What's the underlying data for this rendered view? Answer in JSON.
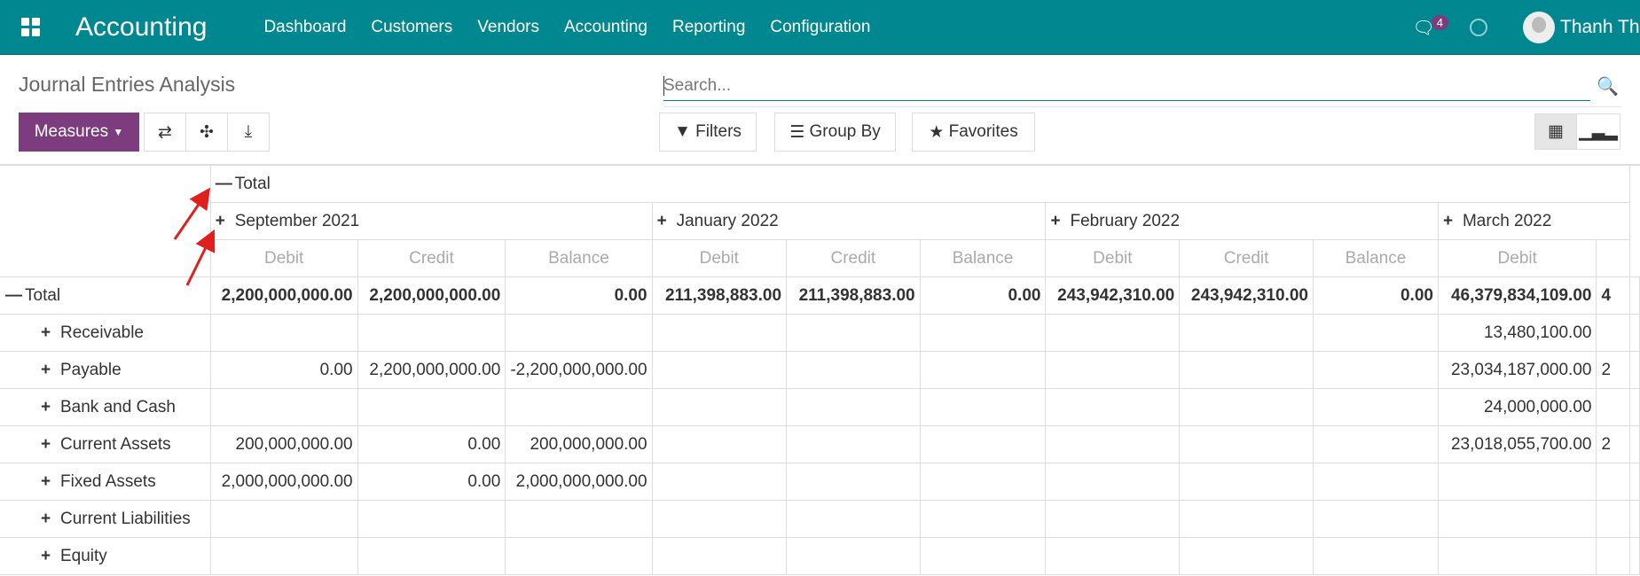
{
  "navbar": {
    "app": "Accounting",
    "menu": [
      "Dashboard",
      "Customers",
      "Vendors",
      "Accounting",
      "Reporting",
      "Configuration"
    ],
    "messages_count": "4",
    "user": "Thanh Thư"
  },
  "page": {
    "title": "Journal Entries Analysis",
    "search_placeholder": "Search...",
    "measures": "Measures",
    "filters": "Filters",
    "group_by": "Group By",
    "favorites": "Favorites"
  },
  "pivot": {
    "col_total": "Total",
    "months": [
      "September 2021",
      "January 2022",
      "February 2022",
      "March 2022"
    ],
    "measures": [
      "Debit",
      "Credit",
      "Balance"
    ],
    "rows": [
      {
        "label": "Total",
        "cells": [
          "2,200,000,000.00",
          "2,200,000,000.00",
          "0.00",
          "211,398,883.00",
          "211,398,883.00",
          "0.00",
          "243,942,310.00",
          "243,942,310.00",
          "0.00",
          "46,379,834,109.00",
          "4"
        ]
      },
      {
        "label": "Receivable",
        "cells": [
          "",
          "",
          "",
          "",
          "",
          "",
          "",
          "",
          "",
          "13,480,100.00",
          ""
        ]
      },
      {
        "label": "Payable",
        "cells": [
          "0.00",
          "2,200,000,000.00",
          "-2,200,000,000.00",
          "",
          "",
          "",
          "",
          "",
          "",
          "23,034,187,000.00",
          "2"
        ]
      },
      {
        "label": "Bank and Cash",
        "cells": [
          "",
          "",
          "",
          "",
          "",
          "",
          "",
          "",
          "",
          "24,000,000.00",
          ""
        ]
      },
      {
        "label": "Current Assets",
        "cells": [
          "200,000,000.00",
          "0.00",
          "200,000,000.00",
          "",
          "",
          "",
          "",
          "",
          "",
          "23,018,055,700.00",
          "2"
        ]
      },
      {
        "label": "Fixed Assets",
        "cells": [
          "2,000,000,000.00",
          "0.00",
          "2,000,000,000.00",
          "",
          "",
          "",
          "",
          "",
          "",
          "",
          ""
        ]
      },
      {
        "label": "Current Liabilities",
        "cells": [
          "",
          "",
          "",
          "",
          "",
          "",
          "",
          "",
          "",
          "",
          ""
        ]
      },
      {
        "label": "Equity",
        "cells": [
          "",
          "",
          "",
          "",
          "",
          "",
          "",
          "",
          "",
          "",
          ""
        ]
      }
    ]
  },
  "colors": {
    "navbar": "#00878f",
    "primary": "#7c3c7e",
    "annotation": "#e0201f"
  }
}
